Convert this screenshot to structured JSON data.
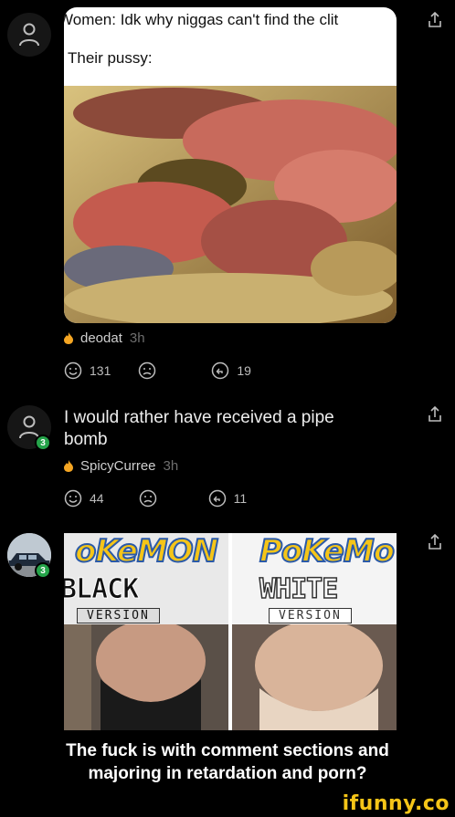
{
  "post": {
    "meme_line1": "Women: Idk why niggas can't find the clit",
    "meme_line2": "Their pussy:",
    "author": "deodat",
    "time": "3h",
    "smiles": "131",
    "replies": "19"
  },
  "comment1": {
    "text": "I would rather have received a pipe bomb",
    "author": "SpicyCurree",
    "time": "3h",
    "level": "3",
    "smiles": "44",
    "replies": "11"
  },
  "comment2": {
    "level": "3",
    "image": {
      "left_logo": "oKeMON",
      "left_version": "BLACK",
      "left_sub": "VERSION",
      "right_logo": "PoKeMo",
      "right_version": "WHITE",
      "right_sub": "VERSION"
    }
  },
  "caption": {
    "line1": "The fuck is with comment sections and",
    "line2": "majoring in retardation and porn?"
  },
  "watermark": "ifunny.co",
  "colors": {
    "background": "#000000",
    "level_badge": "#25a44a",
    "flame": "#f5a623",
    "watermark": "#f5c518"
  },
  "icons": [
    "user-icon",
    "share-icon",
    "flame-icon",
    "smile-icon",
    "frown-icon",
    "reply-icon"
  ]
}
